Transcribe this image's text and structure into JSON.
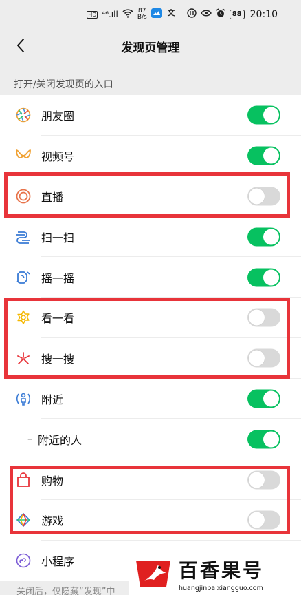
{
  "status_bar": {
    "hd": "HD",
    "signal": "⁴⁶.ıll",
    "net_speed_top": "87",
    "net_speed_bottom": "B/s",
    "battery": "88",
    "time": "20:10"
  },
  "nav": {
    "title": "发现页管理"
  },
  "section_label": "打开/关闭发现页的入口",
  "items": [
    {
      "label": "朋友圈",
      "icon": "moments-icon",
      "enabled": true
    },
    {
      "label": "视频号",
      "icon": "channels-icon",
      "enabled": true
    },
    {
      "label": "直播",
      "icon": "live-icon",
      "enabled": false
    },
    {
      "label": "扫一扫",
      "icon": "scan-icon",
      "enabled": true
    },
    {
      "label": "摇一摇",
      "icon": "shake-icon",
      "enabled": true
    },
    {
      "label": "看一看",
      "icon": "top-stories-icon",
      "enabled": false
    },
    {
      "label": "搜一搜",
      "icon": "search-icon",
      "enabled": false
    },
    {
      "label": "附近",
      "icon": "nearby-icon",
      "enabled": true
    },
    {
      "label": "附近的人",
      "icon": "",
      "enabled": true,
      "sub": true
    },
    {
      "label": "购物",
      "icon": "shopping-icon",
      "enabled": false
    },
    {
      "label": "游戏",
      "icon": "games-icon",
      "enabled": false
    },
    {
      "label": "小程序",
      "icon": "mini-programs-icon",
      "enabled": true
    }
  ],
  "footer_note": "关闭后，仅隐藏“发现”中",
  "watermark": {
    "text": "百香果号",
    "url": "huangjinbaixiangguo.com"
  },
  "colors": {
    "toggle_on": "#07c160",
    "toggle_off": "#d9d9d9",
    "highlight": "#e8343a"
  }
}
